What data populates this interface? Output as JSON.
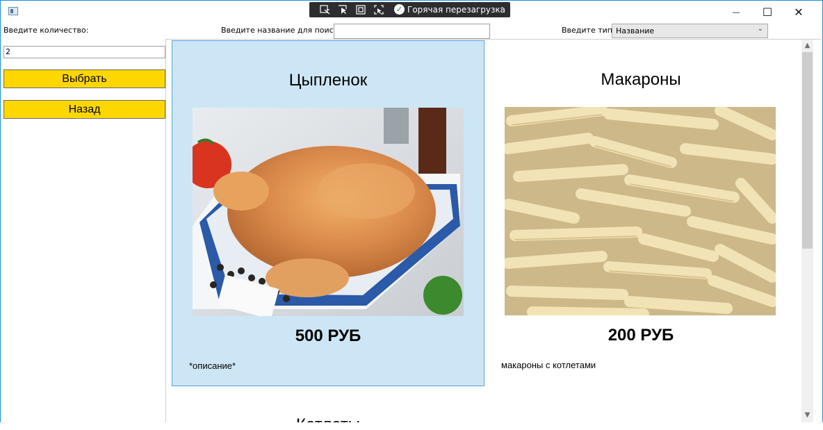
{
  "window": {
    "minimize_glyph": "—",
    "maximize_glyph": "☐",
    "close_glyph": "✕"
  },
  "debug_toolbar": {
    "hot_reload_label": "Горячая перезагрузка"
  },
  "left_panel": {
    "quantity_label": "Введите количество:",
    "quantity_value": "2",
    "select_button": "Выбрать",
    "back_button": "Назад"
  },
  "search": {
    "label": "Введите название для поиска",
    "value": ""
  },
  "type_filter": {
    "label": "Введите тип:",
    "selected": "Название"
  },
  "products": [
    {
      "name": "Цыпленок",
      "price": "500 РУБ",
      "description": "*описание*",
      "selected": true
    },
    {
      "name": "Макароны",
      "price": "200 РУБ",
      "description": "макароны с котлетами",
      "selected": false
    }
  ],
  "partial_next_item": "Котлеты",
  "colors": {
    "button_yellow": "#FFD700",
    "selected_card": "#CDE6F5",
    "selected_border": "#5AA0D8"
  }
}
